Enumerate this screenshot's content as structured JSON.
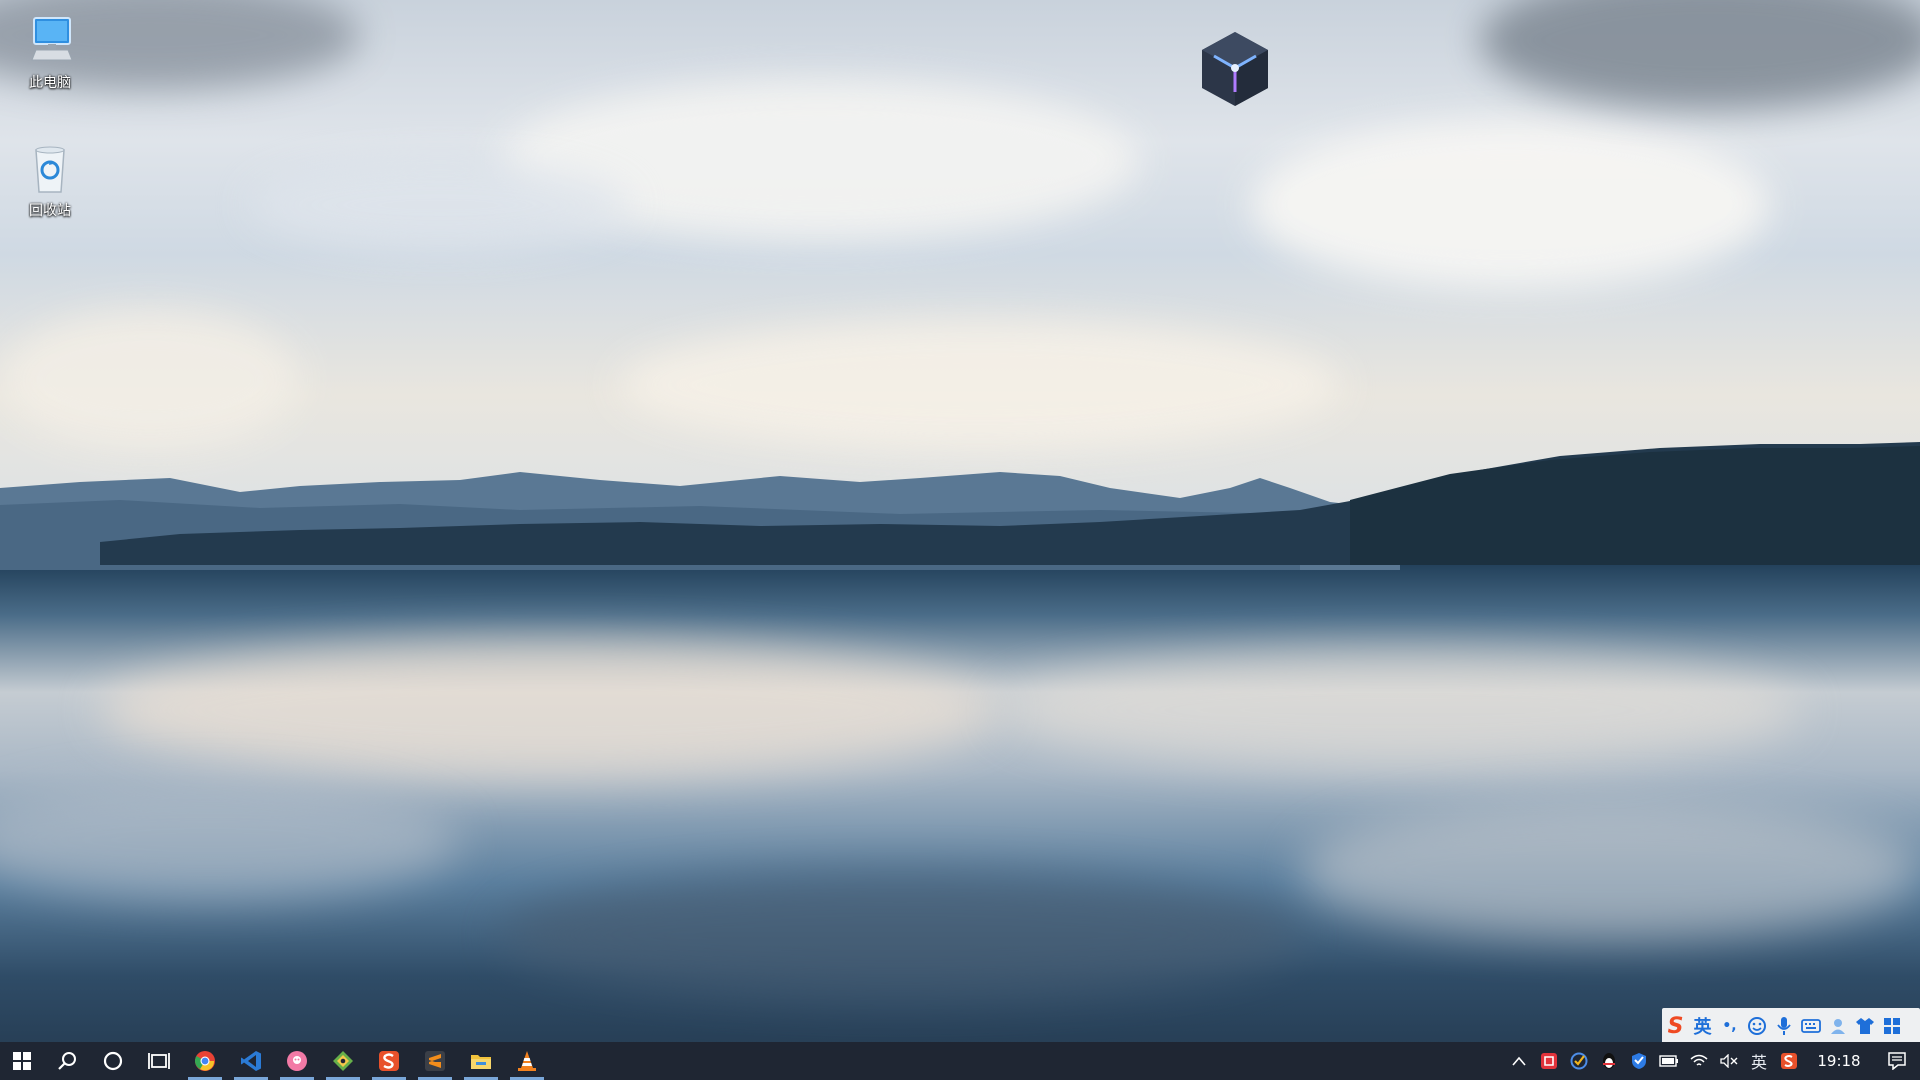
{
  "desktop": {
    "icons": [
      {
        "label": "此电脑",
        "icon": "computer-icon"
      },
      {
        "label": "回收站",
        "icon": "recycle-bin-icon"
      }
    ],
    "widget": {
      "icon": "cube-logo-icon"
    }
  },
  "ime_toolbar": {
    "logo": "S",
    "mode": "英",
    "punct": "•,",
    "icons": [
      "sogou-logo-icon",
      "ime-mode-icon",
      "punctuation-icon",
      "emoji-icon",
      "microphone-icon",
      "keyboard-icon",
      "user-icon",
      "skin-shirt-icon",
      "toolbox-grid-icon"
    ]
  },
  "taskbar": {
    "start": {
      "icon": "windows-start-icon"
    },
    "search": {
      "icon": "search-icon"
    },
    "cortana": {
      "icon": "cortana-circle-icon"
    },
    "task_view": {
      "icon": "task-view-icon"
    },
    "apps": [
      {
        "name": "Google Chrome",
        "icon": "chrome-icon",
        "color": "#e94235"
      },
      {
        "name": "Visual Studio Code",
        "icon": "vscode-icon",
        "color": "#2b7bd6"
      },
      {
        "name": "Pink app",
        "icon": "pink-circle-app-icon",
        "color": "#f27aa6"
      },
      {
        "name": "Sourcetree",
        "icon": "git-diamond-icon",
        "color": "#66b04a"
      },
      {
        "name": "Sogou browser",
        "icon": "sogou-s-icon",
        "color": "#e8512b"
      },
      {
        "name": "Sublime Text",
        "icon": "sublime-text-icon",
        "color": "#f38d1b"
      },
      {
        "name": "File Explorer",
        "icon": "file-explorer-icon",
        "color": "#f2c33c"
      },
      {
        "name": "VLC",
        "icon": "vlc-cone-icon",
        "color": "#f3821f"
      }
    ],
    "tray": {
      "chevron": "^",
      "ime_lang": "英",
      "time": "19:18",
      "items": [
        "red-app-tray-icon",
        "check-tray-icon",
        "qq-penguin-tray-icon",
        "shield-tray-icon",
        "battery-tray-icon",
        "wifi-tray-icon",
        "volume-muted-tray-icon",
        "sogou-tray-icon"
      ],
      "volume_glyph": "🔇"
    }
  },
  "colors": {
    "taskbar_bg": "#1f2633",
    "active_indicator": "#7aa7d9"
  }
}
